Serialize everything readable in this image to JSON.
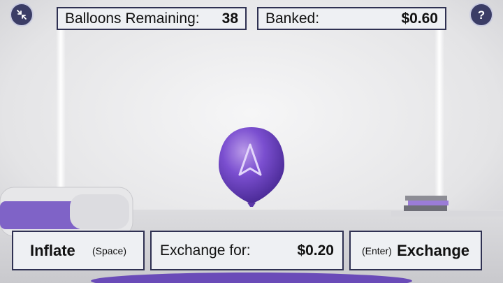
{
  "stats": {
    "remaining_label": "Balloons Remaining:",
    "remaining_value": "38",
    "banked_label": "Banked:",
    "banked_value": "$0.60"
  },
  "controls": {
    "inflate_label": "Inflate",
    "inflate_hint": "(Space)",
    "exchange_for_label": "Exchange for:",
    "exchange_for_value": "$0.20",
    "exchange_hint": "(Enter)",
    "exchange_label": "Exchange"
  },
  "icons": {
    "top_left": "collapse-arrows-icon",
    "top_right": "question-mark-icon",
    "help_glyph": "?"
  },
  "colors": {
    "balloon": "#7b4fd0",
    "accent": "#8e6fd6",
    "panel_border": "#2f3152",
    "round_button": "#3b3d66"
  }
}
